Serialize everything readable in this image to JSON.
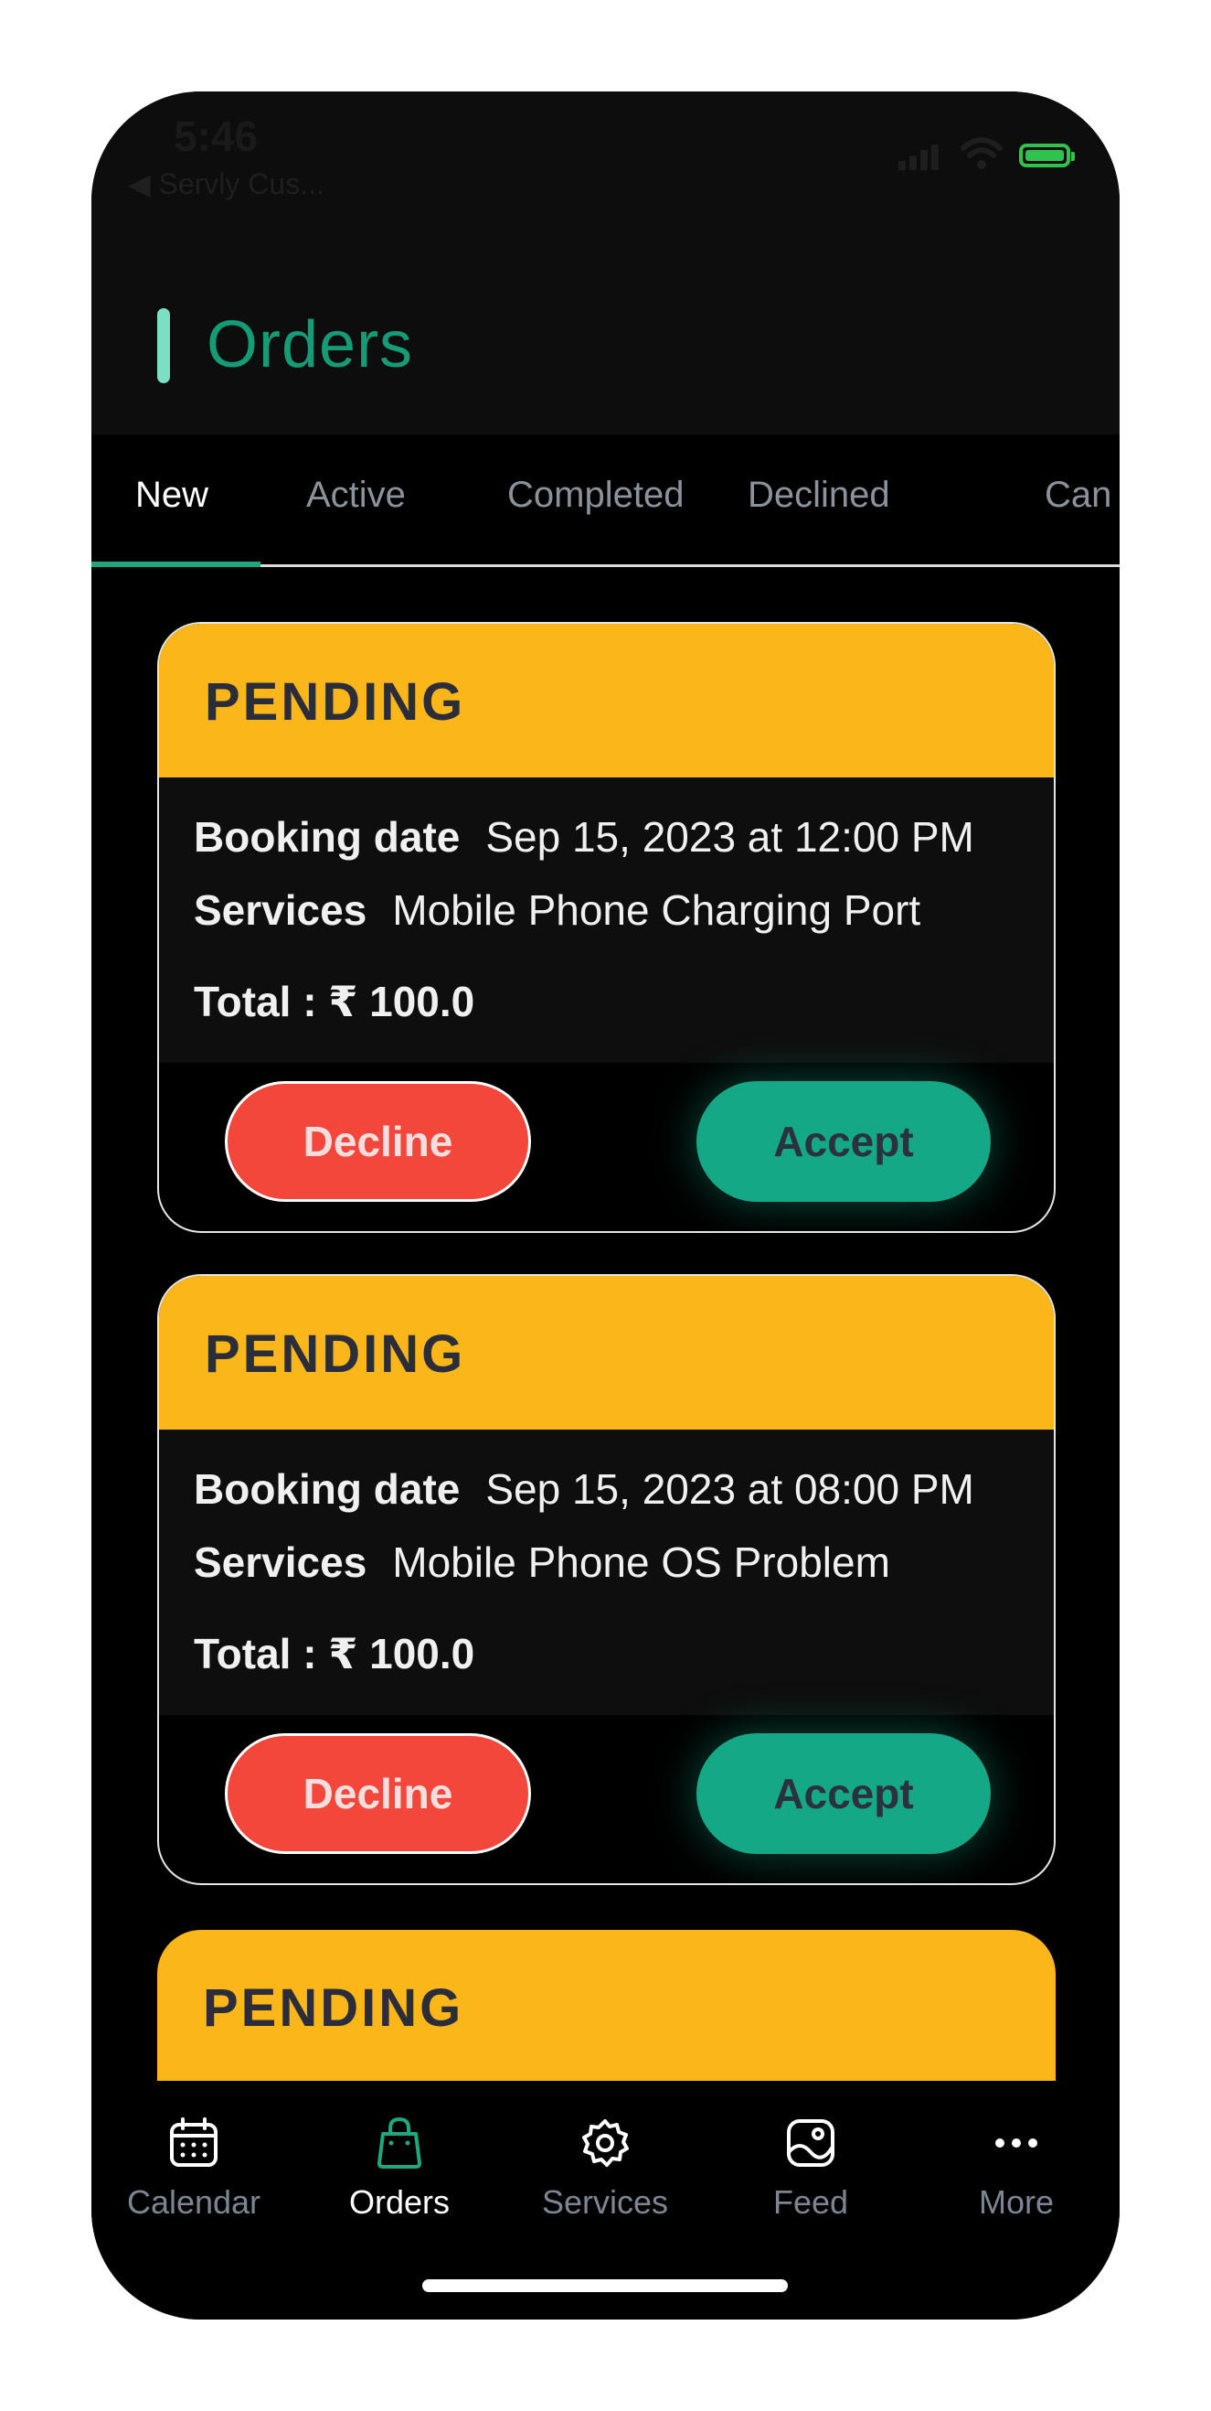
{
  "status_bar": {
    "time": "5:46",
    "back_app": "◀ Servly Cus..."
  },
  "header": {
    "title": "Orders"
  },
  "tabs": [
    {
      "label": "New",
      "active": true
    },
    {
      "label": "Active"
    },
    {
      "label": "Completed"
    },
    {
      "label": "Declined"
    },
    {
      "label": "Can"
    }
  ],
  "orders": [
    {
      "status": "PENDING",
      "booking_label": "Booking date",
      "booking_date": "Sep 15, 2023 at 12:00 PM",
      "services_label": "Services",
      "services": "Mobile Phone Charging Port",
      "total": "Total : ₹ 100.0",
      "decline_label": "Decline",
      "accept_label": "Accept"
    },
    {
      "status": "PENDING",
      "booking_label": "Booking date",
      "booking_date": "Sep 15, 2023 at 08:00 PM",
      "services_label": "Services",
      "services": "Mobile Phone OS Problem",
      "total": "Total : ₹ 100.0",
      "decline_label": "Decline",
      "accept_label": "Accept"
    },
    {
      "status": "PENDING"
    }
  ],
  "nav": [
    {
      "label": "Calendar",
      "icon": "calendar-icon"
    },
    {
      "label": "Orders",
      "icon": "shopping-bag-icon",
      "active": true
    },
    {
      "label": "Services",
      "icon": "gear-icon"
    },
    {
      "label": "Feed",
      "icon": "image-icon"
    },
    {
      "label": "More",
      "icon": "more-dots-icon"
    }
  ],
  "colors": {
    "accent": "#159b76",
    "pending": "#fbb619",
    "decline": "#f4473b",
    "accept": "#14a886",
    "background": "#000000"
  }
}
